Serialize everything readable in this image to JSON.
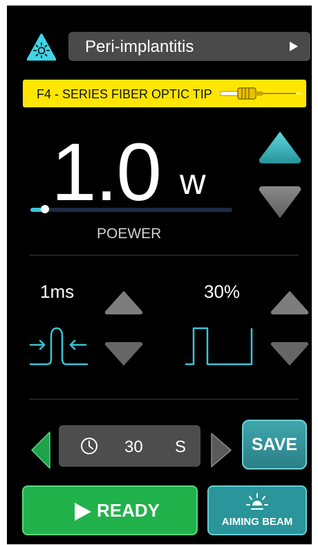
{
  "header": {
    "procedure_label": "Peri-implantitis",
    "procedure_icon": "sun-icon",
    "tip_label": "F4 - SERIES FIBER OPTIC TIP"
  },
  "power": {
    "value": "1.0",
    "unit": "w",
    "label": "POEWER",
    "slider_fraction": 0.05
  },
  "pulse": {
    "width_label": "1ms",
    "duty_label": "30%"
  },
  "timer": {
    "value": "30",
    "unit": "S",
    "icon": "clock-icon"
  },
  "buttons": {
    "save": "SAVE",
    "ready": "READY",
    "aiming_beam": "AIMING BEAM"
  },
  "colors": {
    "background": "#000000",
    "accent_teal": "#38c6d6",
    "tip_bar": "#ffe600",
    "ready_green": "#21b24b",
    "save_teal": "#2f9aa1",
    "timer_arrow_green": "#1ea24a"
  }
}
